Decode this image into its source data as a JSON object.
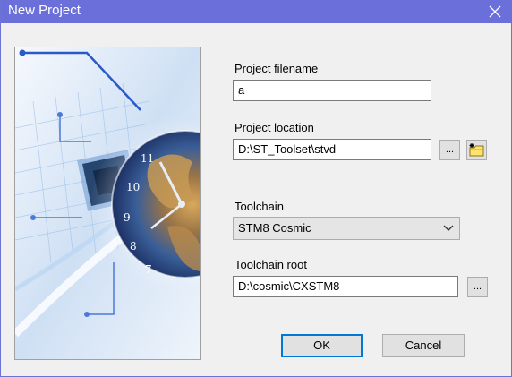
{
  "window": {
    "title": "New Project"
  },
  "icons": {
    "close": "close-icon",
    "browse_folder": "folder-new-icon",
    "dropdown": "chevron-down-icon",
    "illustration": "globe-clock-circuit-illustration"
  },
  "form": {
    "project_filename": {
      "label": "Project filename",
      "value": "a"
    },
    "project_location": {
      "label": "Project location",
      "value": "D:\\ST_Toolset\\stvd",
      "browse_label": "..."
    },
    "toolchain": {
      "label": "Toolchain",
      "selected": "STM8 Cosmic"
    },
    "toolchain_root": {
      "label": "Toolchain root",
      "value": "D:\\cosmic\\CXSTM8",
      "browse_label": "..."
    }
  },
  "buttons": {
    "ok": "OK",
    "cancel": "Cancel"
  },
  "colors": {
    "titlebar": "#6b6fd9",
    "dialog_bg": "#f0f0f0",
    "focus_border": "#0078d7"
  }
}
